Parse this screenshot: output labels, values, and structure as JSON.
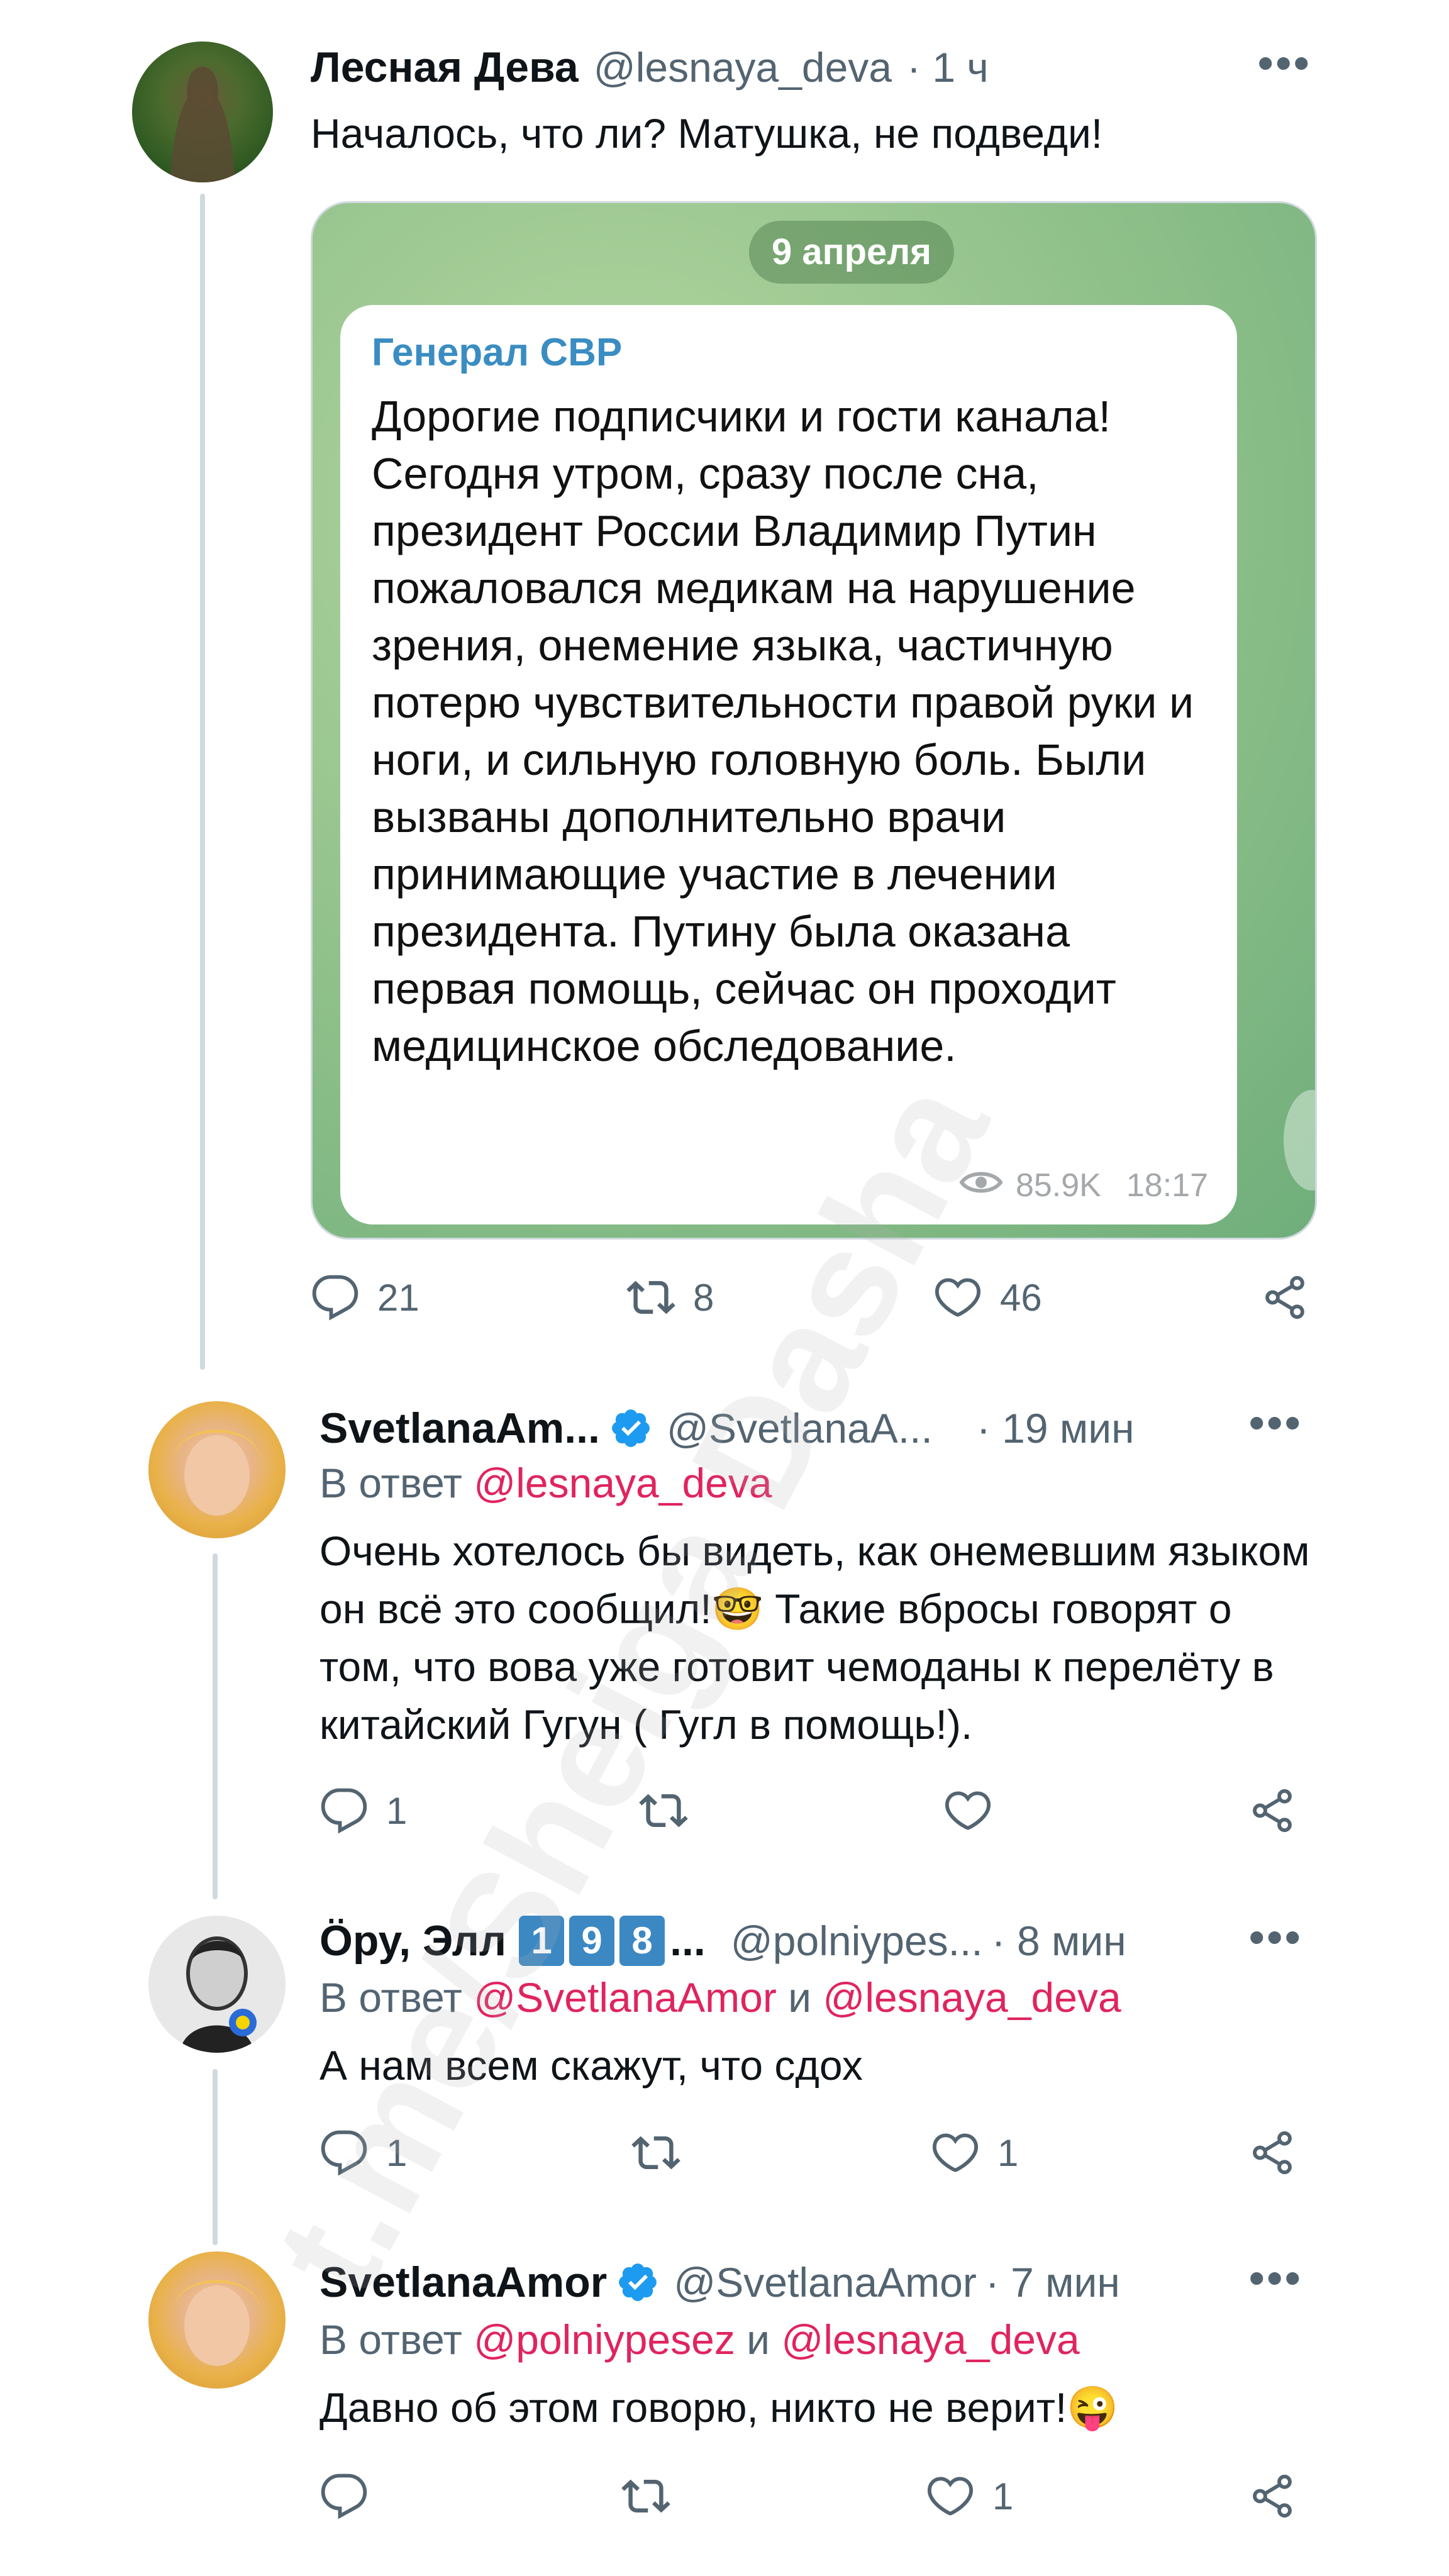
{
  "watermark": "t.me/Sheiga Dasha",
  "colors": {
    "mention": "#e0245e",
    "verified": "#1d9bf0",
    "badge": "#3b88c3",
    "telegram_channel": "#3a8dc2"
  },
  "tweets": [
    {
      "name": "Лесная Дева",
      "handle": "@lesnaya_deva",
      "time": "· 1 ч",
      "text": "Началось, что ли? Матушка, не подведи!",
      "actions": {
        "replies": "21",
        "retweets": "8",
        "likes": "46"
      },
      "telegram": {
        "date": "9 апреля",
        "channel": "Генерал СВР",
        "text": "Дорогие подписчики и гости канала! Сегодня утром, сразу после сна, президент России Владимир Путин пожаловался медикам на нарушение зрения, онемение языка, частичную потерю чувствительности правой руки и ноги, и сильную головную боль. Были вызваны дополнительно врачи принимающие участие в лечении президента. Путину была оказана первая помощь, сейчас он проходит медицинское обследование.",
        "views": "85.9K",
        "time": "18:17"
      }
    },
    {
      "name": "SvetlanaAm...",
      "handle": "@SvetlanaA...",
      "time": "· 19 мин",
      "reply_prefix": "В ответ",
      "reply_mention_1": "@lesnaya_deva",
      "text": "Очень хотелось бы видеть, как онемевшим языком он всё это сообщил!🤓 Такие вбросы говорят о том, что вова уже готовит чемоданы к перелёту в китайский Гугун ( Гугл в помощь!).",
      "actions": {
        "replies": "1",
        "retweets": "",
        "likes": ""
      }
    },
    {
      "name": "Öру, Элл",
      "badges": [
        "1",
        "9",
        "8"
      ],
      "ellipsis": "...",
      "handle": "@polniypes...",
      "time": "· 8 мин",
      "reply_prefix": "В ответ",
      "reply_mention_1": "@SvetlanaAmor",
      "reply_and": "и",
      "reply_mention_2": "@lesnaya_deva",
      "text": "А нам всем скажут, что сдох",
      "actions": {
        "replies": "1",
        "retweets": "",
        "likes": "1"
      }
    },
    {
      "name": "SvetlanaAmor",
      "handle": "@SvetlanaAmor",
      "time": "· 7 мин",
      "reply_prefix": "В ответ",
      "reply_mention_1": "@polniypesez",
      "reply_and": "и",
      "reply_mention_2": "@lesnaya_deva",
      "text": "Давно об этом говорю, никто не верит!😜",
      "actions": {
        "replies": "",
        "retweets": "",
        "likes": "1"
      }
    }
  ]
}
